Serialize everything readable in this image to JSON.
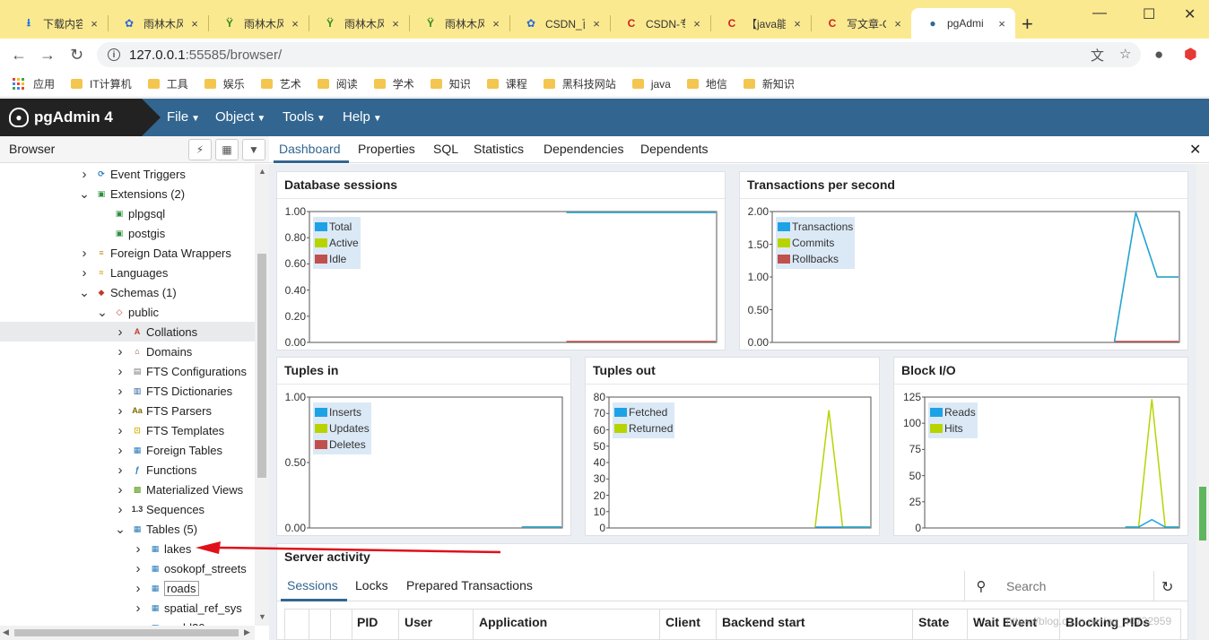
{
  "browser_tabs": [
    {
      "title": "下载内容",
      "icon": "download-icon"
    },
    {
      "title": "雨林木风",
      "icon": "paw-icon"
    },
    {
      "title": "雨林木风",
      "icon": "leaf-icon"
    },
    {
      "title": "雨林木风",
      "icon": "leaf-icon"
    },
    {
      "title": "雨林木风",
      "icon": "leaf-icon"
    },
    {
      "title": "CSDN_百",
      "icon": "paw-icon"
    },
    {
      "title": "CSDN-专",
      "icon": "csdn-icon"
    },
    {
      "title": "【java能",
      "icon": "csdn-icon"
    },
    {
      "title": "写文章-C",
      "icon": "csdn-icon"
    },
    {
      "title": "pgAdmi",
      "icon": "elephant-icon"
    }
  ],
  "address": {
    "host": "127.0.0.1",
    "rest": ":55585/browser/"
  },
  "bookmarks": [
    {
      "label": "应用",
      "type": "apps"
    },
    {
      "label": "IT计算机",
      "type": "folder"
    },
    {
      "label": "工具",
      "type": "folder"
    },
    {
      "label": "娱乐",
      "type": "folder"
    },
    {
      "label": "艺术",
      "type": "folder"
    },
    {
      "label": "阅读",
      "type": "folder"
    },
    {
      "label": "学术",
      "type": "folder"
    },
    {
      "label": "知识",
      "type": "folder"
    },
    {
      "label": "课程",
      "type": "folder"
    },
    {
      "label": "黑科技网站",
      "type": "folder"
    },
    {
      "label": "java",
      "type": "folder"
    },
    {
      "label": "地信",
      "type": "folder"
    },
    {
      "label": "新知识",
      "type": "folder"
    }
  ],
  "app": {
    "brand": "pgAdmin 4",
    "menus": [
      "File",
      "Object",
      "Tools",
      "Help"
    ]
  },
  "browser_panel": {
    "title": "Browser",
    "tree": [
      {
        "label": "Event Triggers",
        "depth": 4,
        "expander": "collapsed",
        "icon": "event-trigger-icon"
      },
      {
        "label": "Extensions (2)",
        "depth": 4,
        "expander": "expanded",
        "icon": "extension-icon"
      },
      {
        "label": "plpgsql",
        "depth": 5,
        "expander": "none",
        "icon": "extension-icon"
      },
      {
        "label": "postgis",
        "depth": 5,
        "expander": "none",
        "icon": "extension-icon"
      },
      {
        "label": "Foreign Data Wrappers",
        "depth": 4,
        "expander": "collapsed",
        "icon": "fdw-icon"
      },
      {
        "label": "Languages",
        "depth": 4,
        "expander": "collapsed",
        "icon": "language-icon"
      },
      {
        "label": "Schemas (1)",
        "depth": 4,
        "expander": "expanded",
        "icon": "schemas-icon"
      },
      {
        "label": "public",
        "depth": 5,
        "expander": "expanded",
        "icon": "schema-icon"
      },
      {
        "label": "Collations",
        "depth": 6,
        "expander": "collapsed",
        "icon": "collation-icon",
        "selected": true
      },
      {
        "label": "Domains",
        "depth": 6,
        "expander": "collapsed",
        "icon": "domain-icon"
      },
      {
        "label": "FTS Configurations",
        "depth": 6,
        "expander": "collapsed",
        "icon": "fts-configuration-icon"
      },
      {
        "label": "FTS Dictionaries",
        "depth": 6,
        "expander": "collapsed",
        "icon": "fts-dictionary-icon"
      },
      {
        "label": "FTS Parsers",
        "depth": 6,
        "expander": "collapsed",
        "icon": "fts-parser-icon"
      },
      {
        "label": "FTS Templates",
        "depth": 6,
        "expander": "collapsed",
        "icon": "fts-template-icon"
      },
      {
        "label": "Foreign Tables",
        "depth": 6,
        "expander": "collapsed",
        "icon": "foreign-table-icon"
      },
      {
        "label": "Functions",
        "depth": 6,
        "expander": "collapsed",
        "icon": "function-icon"
      },
      {
        "label": "Materialized Views",
        "depth": 6,
        "expander": "collapsed",
        "icon": "materialized-view-icon"
      },
      {
        "label": "Sequences",
        "depth": 6,
        "expander": "collapsed",
        "icon": "sequence-icon"
      },
      {
        "label": "Tables (5)",
        "depth": 6,
        "expander": "expanded",
        "icon": "tables-icon"
      },
      {
        "label": "lakes",
        "depth": 7,
        "expander": "collapsed",
        "icon": "table-icon"
      },
      {
        "label": "osokopf_streets",
        "depth": 7,
        "expander": "collapsed",
        "icon": "table-icon"
      },
      {
        "label": "roads",
        "depth": 7,
        "expander": "collapsed",
        "icon": "table-icon",
        "boxed": true
      },
      {
        "label": "spatial_ref_sys",
        "depth": 7,
        "expander": "collapsed",
        "icon": "table-icon"
      },
      {
        "label": "world30",
        "depth": 7,
        "expander": "collapsed",
        "icon": "table-icon"
      }
    ]
  },
  "main_tabs": [
    "Dashboard",
    "Properties",
    "SQL",
    "Statistics",
    "Dependencies",
    "Dependents"
  ],
  "colors": {
    "blue": "#1ea2e6",
    "green": "#b8d400",
    "red": "#c0504d",
    "accent": "#326690"
  },
  "dashboard": {
    "database_sessions": {
      "title": "Database sessions",
      "y_ticks": [
        "1.00",
        "0.80",
        "0.60",
        "0.40",
        "0.20",
        "0.00"
      ],
      "legend": [
        "Total",
        "Active",
        "Idle"
      ]
    },
    "transactions_per_second": {
      "title": "Transactions per second",
      "y_ticks": [
        "2.00",
        "1.50",
        "1.00",
        "0.50",
        "0.00"
      ],
      "legend": [
        "Transactions",
        "Commits",
        "Rollbacks"
      ]
    },
    "tuples_in": {
      "title": "Tuples in",
      "y_ticks": [
        "1.00",
        "0.50",
        "0.00"
      ],
      "legend": [
        "Inserts",
        "Updates",
        "Deletes"
      ]
    },
    "tuples_out": {
      "title": "Tuples out",
      "y_ticks": [
        "80",
        "70",
        "60",
        "50",
        "40",
        "30",
        "20",
        "10",
        "0"
      ],
      "legend": [
        "Fetched",
        "Returned"
      ]
    },
    "block_io": {
      "title": "Block I/O",
      "y_ticks": [
        "125",
        "100",
        "75",
        "50",
        "25",
        "0"
      ],
      "legend": [
        "Reads",
        "Hits"
      ]
    }
  },
  "chart_data": [
    {
      "type": "line",
      "title": "Database sessions",
      "ylim": [
        0,
        1
      ],
      "x": [
        0,
        1,
        2,
        3,
        4,
        5,
        6,
        7,
        8,
        9,
        10,
        11,
        12,
        13,
        14,
        15,
        16,
        17,
        18,
        19
      ],
      "series": [
        {
          "name": "Total",
          "values": [
            null,
            null,
            null,
            null,
            null,
            null,
            null,
            null,
            null,
            null,
            null,
            null,
            1,
            1,
            1,
            1,
            1,
            1,
            1,
            1
          ]
        },
        {
          "name": "Active",
          "values": [
            null,
            null,
            null,
            null,
            null,
            null,
            null,
            null,
            null,
            null,
            null,
            null,
            1,
            1,
            1,
            1,
            1,
            1,
            1,
            1
          ]
        },
        {
          "name": "Idle",
          "values": [
            null,
            null,
            null,
            null,
            null,
            null,
            null,
            null,
            null,
            null,
            null,
            null,
            0,
            0,
            0,
            0,
            0,
            0,
            0,
            0
          ]
        }
      ]
    },
    {
      "type": "line",
      "title": "Transactions per second",
      "ylim": [
        0,
        2
      ],
      "x": [
        0,
        1,
        2,
        3,
        4,
        5,
        6,
        7,
        8,
        9,
        10,
        11,
        12,
        13,
        14,
        15,
        16,
        17,
        18,
        19
      ],
      "series": [
        {
          "name": "Transactions",
          "values": [
            null,
            null,
            null,
            null,
            null,
            null,
            null,
            null,
            null,
            null,
            null,
            null,
            null,
            null,
            null,
            null,
            0,
            2,
            1,
            1
          ]
        },
        {
          "name": "Commits",
          "values": [
            null,
            null,
            null,
            null,
            null,
            null,
            null,
            null,
            null,
            null,
            null,
            null,
            null,
            null,
            null,
            null,
            0,
            2,
            1,
            1
          ]
        },
        {
          "name": "Rollbacks",
          "values": [
            null,
            null,
            null,
            null,
            null,
            null,
            null,
            null,
            null,
            null,
            null,
            null,
            null,
            null,
            null,
            null,
            0,
            0,
            0,
            0
          ]
        }
      ]
    },
    {
      "type": "line",
      "title": "Tuples in",
      "ylim": [
        0,
        1
      ],
      "x": [
        0,
        1,
        2,
        3,
        4,
        5,
        6,
        7,
        8,
        9,
        10,
        11,
        12,
        13,
        14,
        15,
        16,
        17,
        18,
        19
      ],
      "series": [
        {
          "name": "Inserts",
          "values": [
            null,
            null,
            null,
            null,
            null,
            null,
            null,
            null,
            null,
            null,
            null,
            null,
            null,
            null,
            null,
            null,
            0,
            0,
            0,
            0
          ]
        },
        {
          "name": "Updates",
          "values": [
            null,
            null,
            null,
            null,
            null,
            null,
            null,
            null,
            null,
            null,
            null,
            null,
            null,
            null,
            null,
            null,
            0,
            0,
            0,
            0
          ]
        },
        {
          "name": "Deletes",
          "values": [
            null,
            null,
            null,
            null,
            null,
            null,
            null,
            null,
            null,
            null,
            null,
            null,
            null,
            null,
            null,
            null,
            0,
            0,
            0,
            0
          ]
        }
      ]
    },
    {
      "type": "line",
      "title": "Tuples out",
      "ylim": [
        0,
        80
      ],
      "x": [
        0,
        1,
        2,
        3,
        4,
        5,
        6,
        7,
        8,
        9,
        10,
        11,
        12,
        13,
        14,
        15,
        16,
        17,
        18,
        19
      ],
      "series": [
        {
          "name": "Fetched",
          "values": [
            null,
            null,
            null,
            null,
            null,
            null,
            null,
            null,
            null,
            null,
            null,
            null,
            null,
            null,
            null,
            0,
            0,
            0,
            0,
            0
          ]
        },
        {
          "name": "Returned",
          "values": [
            null,
            null,
            null,
            null,
            null,
            null,
            null,
            null,
            null,
            null,
            null,
            null,
            null,
            null,
            null,
            0,
            72,
            0,
            0,
            0
          ]
        }
      ]
    },
    {
      "type": "line",
      "title": "Block I/O",
      "ylim": [
        0,
        125
      ],
      "x": [
        0,
        1,
        2,
        3,
        4,
        5,
        6,
        7,
        8,
        9,
        10,
        11,
        12,
        13,
        14,
        15,
        16,
        17,
        18,
        19
      ],
      "series": [
        {
          "name": "Reads",
          "values": [
            null,
            null,
            null,
            null,
            null,
            null,
            null,
            null,
            null,
            null,
            null,
            null,
            null,
            null,
            null,
            0,
            0,
            8,
            0,
            0
          ]
        },
        {
          "name": "Hits",
          "values": [
            null,
            null,
            null,
            null,
            null,
            null,
            null,
            null,
            null,
            null,
            null,
            null,
            null,
            null,
            null,
            0,
            0,
            123,
            0,
            0
          ]
        }
      ]
    }
  ],
  "server_activity": {
    "title": "Server activity",
    "tabs": [
      "Sessions",
      "Locks",
      "Prepared Transactions"
    ],
    "search_placeholder": "Search",
    "columns": [
      "PID",
      "User",
      "Application",
      "Client",
      "Backend start",
      "State",
      "Wait Event",
      "Blocking PIDs"
    ]
  },
  "watermark": "https://blog.csdn.net/qq_40732959"
}
